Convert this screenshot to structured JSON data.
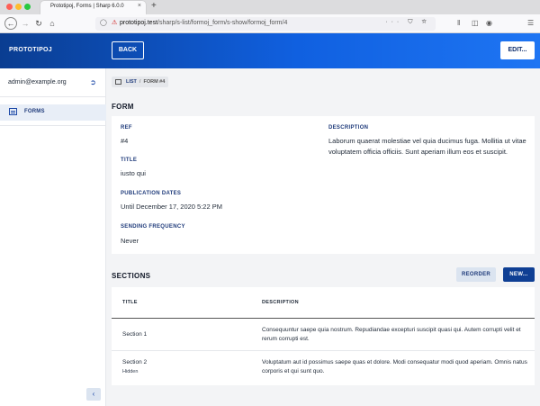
{
  "browser": {
    "tab_title": "Prototipoj, Forms | Sharp 6.0.0",
    "tab_close": "×",
    "new_tab": "+",
    "url_prefix": "prototipoj.test",
    "url_path": "/sharp/s-list/formoj_form/s-show/formoj_form/4",
    "url_icons": "··· ⛉ ☆",
    "nav": {
      "back": "←",
      "forward": "→",
      "reload": "↻",
      "home": "⌂"
    },
    "toolbar_icons": [
      "library-icon",
      "sidebar-icon",
      "account-icon",
      "menu-icon"
    ]
  },
  "header": {
    "brand": "PROTOTIPOJ",
    "back_label": "BACK",
    "edit_label": "EDIT..."
  },
  "sidebar": {
    "user_email": "admin@example.org",
    "logout_icon": "logout-icon",
    "items": [
      {
        "label": "FORMS",
        "icon": "forms-icon",
        "active": true
      }
    ],
    "collapse_glyph": "‹"
  },
  "breadcrumb": {
    "list_label": "LIST",
    "separator": "/",
    "current": "FORM #4"
  },
  "form": {
    "section_title": "FORM",
    "fields": {
      "ref": {
        "label": "REF",
        "value": "#4"
      },
      "title": {
        "label": "TITLE",
        "value": "iusto qui"
      },
      "publication_dates": {
        "label": "PUBLICATION DATES",
        "value": "Until December 17, 2020 5:22 PM"
      },
      "sending_frequency": {
        "label": "SENDING FREQUENCY",
        "value": "Never"
      },
      "description": {
        "label": "DESCRIPTION",
        "value": "Laborum quaerat molestiae vel quia ducimus fuga. Mollitia ut vitae voluptatem officia officiis. Sunt aperiam illum eos et suscipit."
      }
    }
  },
  "sections": {
    "title": "SECTIONS",
    "reorder_label": "REORDER",
    "new_label": "NEW...",
    "columns": [
      "TITLE",
      "DESCRIPTION"
    ],
    "rows": [
      {
        "title": "Section 1",
        "badge": "",
        "description": "Consequuntur saepe quia nostrum. Repudiandae excepturi suscipit quasi qui. Autem corrupti velit et rerum corrupti est."
      },
      {
        "title": "Section 2",
        "badge": "Hidden",
        "description": "Voluptatum aut id possimus saepe quas et dolore. Modi consequatur modi quod aperiam. Omnis natus corporis et qui sunt quo."
      }
    ]
  },
  "colors": {
    "header_start": "#0a3d91",
    "header_end": "#1e75f3",
    "primary_button": "#0f3f94",
    "secondary_button": "#dbe4f0",
    "label_blue": "#1e3a7a"
  }
}
